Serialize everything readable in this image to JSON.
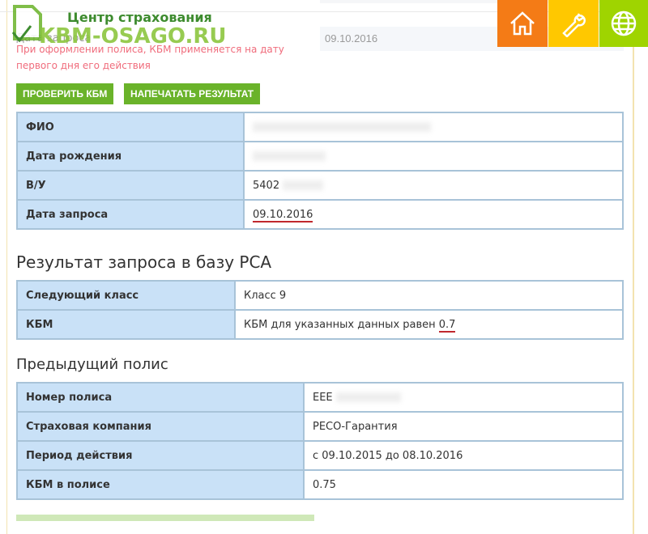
{
  "logo": {
    "line1": "Центр страхования",
    "line2": "KBM-OSAGO.RU"
  },
  "nav": [
    {
      "icon": "home-icon",
      "color": "#f47b16"
    },
    {
      "icon": "wrench-icon",
      "color": "#ffc800"
    },
    {
      "icon": "globe-icon",
      "color": "#9fd400"
    }
  ],
  "form": {
    "date_label": "Дата запроса",
    "date_value": "09.10.2016",
    "note": "При оформлении полиса, КБМ применяется на дату первого дня его действия"
  },
  "buttons": {
    "check": "ПРОВЕРИТЬ КБМ",
    "print": "НАПЕЧАТАТЬ РЕЗУЛЬТАТ"
  },
  "person": [
    {
      "k": "ФИО",
      "v": ""
    },
    {
      "k": "Дата рождения",
      "v": ""
    },
    {
      "k": "В/У",
      "v": "5402"
    },
    {
      "k": "Дата запроса",
      "v": "09.10.2016"
    }
  ],
  "result": {
    "title": "Результат запроса в базу РСА",
    "rows": [
      {
        "k": "Следующий класс",
        "v": "Класс 9"
      },
      {
        "k": "КБМ",
        "v": "КБМ для указанных данных равен ",
        "v2": "0.7"
      }
    ]
  },
  "prev": {
    "title": "Предыдущий полис",
    "rows": [
      {
        "k": "Номер полиса",
        "v": "ЕЕЕ"
      },
      {
        "k": "Страховая компания",
        "v": "РЕСО-Гарантия"
      },
      {
        "k": "Период действия",
        "v": "с 09.10.2015 до 08.10.2016"
      },
      {
        "k": "КБМ в полисе",
        "v": "0.75"
      }
    ]
  }
}
